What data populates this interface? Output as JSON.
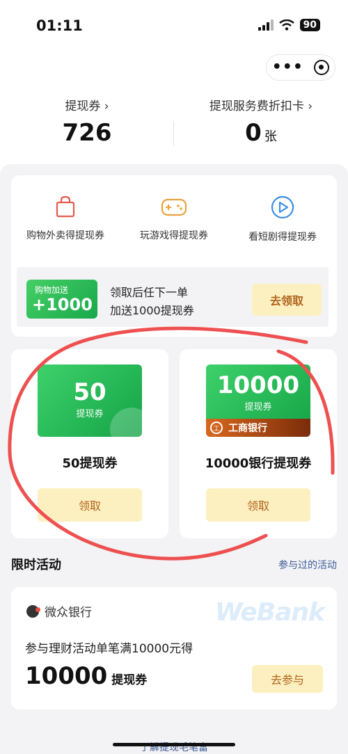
{
  "status_bar": {
    "time": "01:11",
    "battery": "90"
  },
  "stats": {
    "voucher_label": "提现券 ›",
    "voucher_value": "726",
    "discount_label": "提现服务费折扣卡 ›",
    "discount_value": "0",
    "discount_unit": "张"
  },
  "ways": [
    {
      "label": "购物外卖得提现券",
      "icon": "shopping-bag-icon"
    },
    {
      "label": "玩游戏得提现券",
      "icon": "gamepad-icon"
    },
    {
      "label": "看短剧得提现券",
      "icon": "play-icon"
    }
  ],
  "promo": {
    "badge_tag": "购物加送",
    "badge_amount": "+1000",
    "line1": "领取后任下一单",
    "line2": "加送1000提现券",
    "button": "去领取"
  },
  "coupons": [
    {
      "amount": "50",
      "sub": "提现券",
      "title": "50提现券",
      "button": "领取"
    },
    {
      "amount": "10000",
      "sub": "提现券",
      "bank": "工商银行",
      "title": "10000银行提现券",
      "button": "领取"
    }
  ],
  "section": {
    "title": "限时活动",
    "link": "参与过的活动"
  },
  "activity": {
    "bank_name": "微众银行",
    "watermark": "WeBank",
    "desc": "参与理财活动单笔满10000元得",
    "amount": "10000",
    "unit": "提现券",
    "button": "去参与"
  },
  "bottom": {
    "text": "了解提现毛笔富"
  },
  "colors": {
    "green": "#1fb053",
    "button_bg": "#fdf0c0",
    "button_text": "#b0641c",
    "link": "#3d5a99",
    "circle": "#ee5050"
  }
}
